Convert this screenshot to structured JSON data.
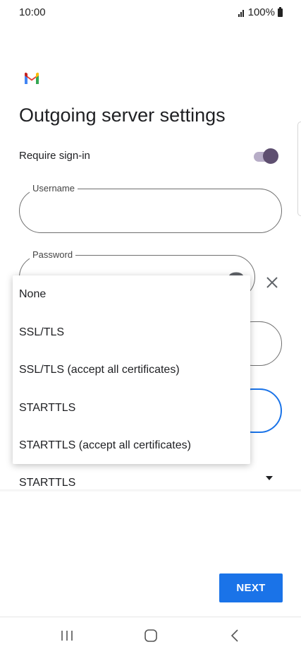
{
  "status_bar": {
    "time": "10:00",
    "battery": "100%"
  },
  "header": {
    "title": "Outgoing server settings"
  },
  "require_signin": {
    "label": "Require sign-in",
    "enabled": true
  },
  "username": {
    "label": "Username",
    "value": ""
  },
  "password": {
    "label": "Password",
    "value": ""
  },
  "security": {
    "selected": "STARTTLS"
  },
  "dropdown": {
    "options": [
      "None",
      "SSL/TLS",
      "SSL/TLS (accept all certificates)",
      "STARTTLS",
      "STARTTLS (accept all certificates)"
    ]
  },
  "footer": {
    "next_label": "NEXT"
  },
  "colors": {
    "accent": "#1a73e8",
    "toggle_knob": "#5e4f70",
    "toggle_track": "#b7adc7"
  },
  "icons": [
    "gmail-logo",
    "eye-icon",
    "close-icon",
    "dropdown-arrow-icon",
    "recents-icon",
    "home-icon",
    "back-icon"
  ]
}
